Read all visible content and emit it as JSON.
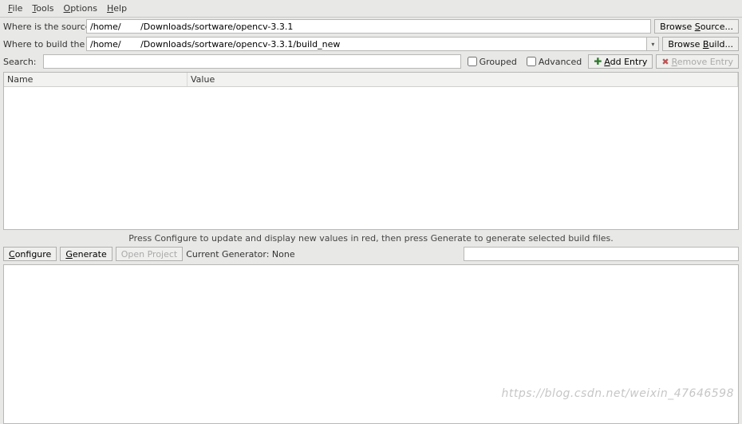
{
  "menu": {
    "file": "File",
    "tools": "Tools",
    "options": "Options",
    "help": "Help"
  },
  "labels": {
    "source": "Where is the source code:",
    "build": "Where to build the binaries:",
    "search": "Search:"
  },
  "paths": {
    "source": "/home/       /Downloads/sortware/opencv-3.3.1",
    "build": "/home/       /Downloads/sortware/opencv-3.3.1/build_new"
  },
  "buttons": {
    "browse_source": "Browse Source...",
    "browse_build": "Browse Build...",
    "add_entry": "Add Entry",
    "remove_entry": "Remove Entry",
    "configure": "Configure",
    "generate": "Generate",
    "open_project": "Open Project"
  },
  "checkboxes": {
    "grouped": "Grouped",
    "advanced": "Advanced"
  },
  "grid": {
    "col_name": "Name",
    "col_value": "Value"
  },
  "hint": "Press Configure to update and display new values in red, then press Generate to generate selected build files.",
  "generator_label": "Current Generator: None",
  "watermark": "https://blog.csdn.net/weixin_47646598"
}
